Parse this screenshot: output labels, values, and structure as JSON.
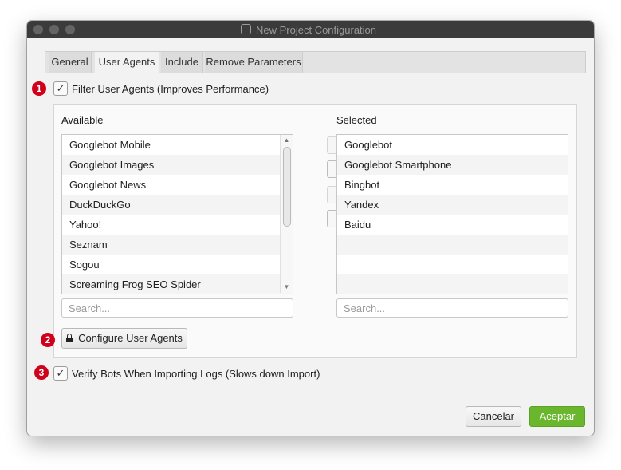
{
  "window": {
    "title": "New Project Configuration"
  },
  "tabs": [
    {
      "label": "General"
    },
    {
      "label": "User Agents"
    },
    {
      "label": "Include"
    },
    {
      "label": "Remove Parameters"
    }
  ],
  "filter": {
    "label": "Filter User Agents (Improves Performance)",
    "checked": true,
    "badge": "1"
  },
  "available": {
    "heading": "Available",
    "items": [
      "Googlebot Mobile",
      "Googlebot Images",
      "Googlebot News",
      "DuckDuckGo",
      "Yahoo!",
      "Seznam",
      "Sogou",
      "Screaming Frog SEO Spider"
    ],
    "search_placeholder": "Search..."
  },
  "selected": {
    "heading": "Selected",
    "items": [
      "Googlebot",
      "Googlebot Smartphone",
      "Bingbot",
      "Yandex",
      "Baidu",
      "",
      "",
      ""
    ],
    "search_placeholder": "Search..."
  },
  "move_buttons": {
    "add": "›",
    "add_all": "»",
    "remove": "‹",
    "remove_all": "«"
  },
  "configure": {
    "label": "Configure User Agents",
    "badge": "2"
  },
  "verify": {
    "label": "Verify Bots When Importing Logs (Slows down Import)",
    "checked": true,
    "badge": "3"
  },
  "footer": {
    "cancel": "Cancelar",
    "ok": "Aceptar"
  }
}
